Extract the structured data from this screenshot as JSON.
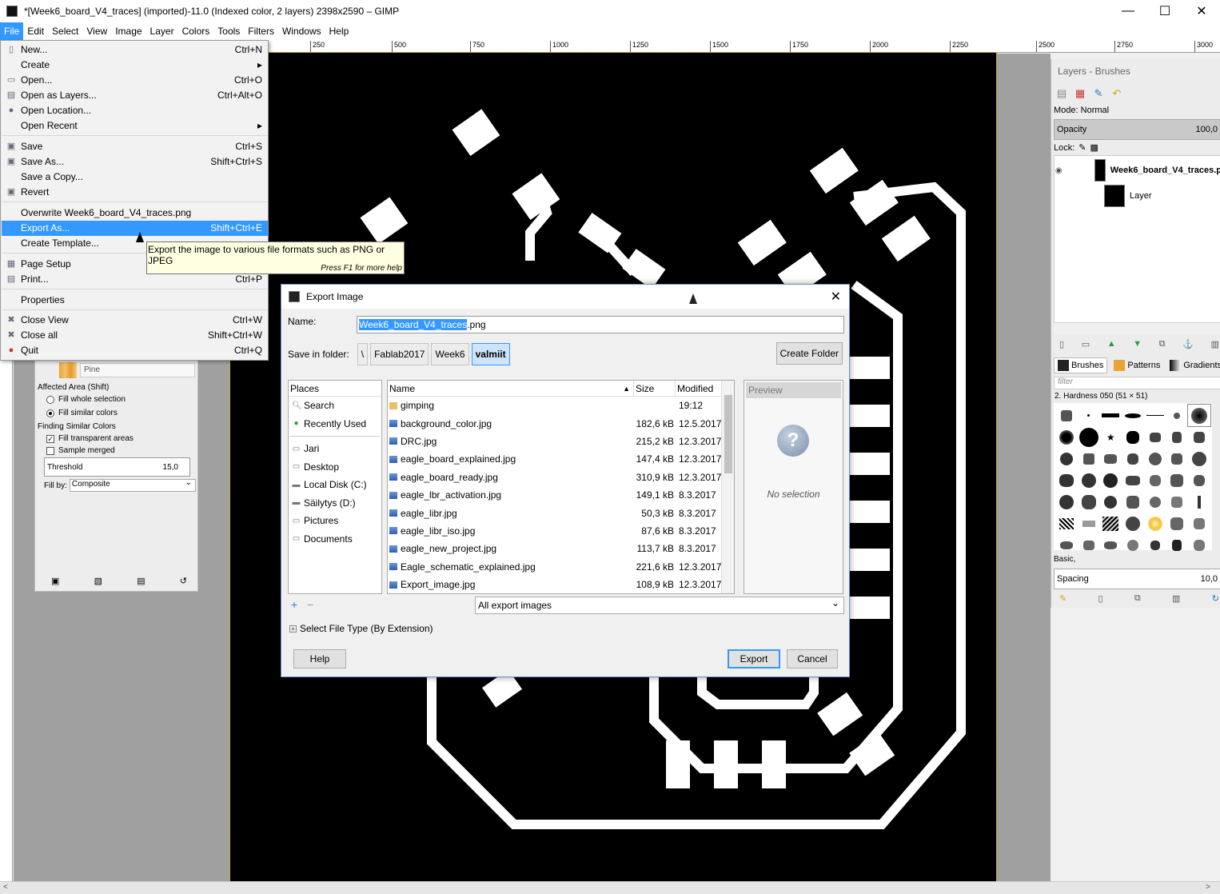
{
  "window": {
    "title": "*[Week6_board_V4_traces] (imported)-11.0 (Indexed color, 2 layers) 2398x2590 – GIMP",
    "minimize": "—",
    "maximize": "☐",
    "close": "✕"
  },
  "menubar": [
    "File",
    "Edit",
    "Select",
    "View",
    "Image",
    "Layer",
    "Colors",
    "Tools",
    "Filters",
    "Windows",
    "Help"
  ],
  "ruler": {
    "top_labels": [
      "250",
      "500",
      "750",
      "1000",
      "1250",
      "1500",
      "1750",
      "2000",
      "2250",
      "2500",
      "2750",
      "3000"
    ]
  },
  "file_menu": {
    "items": [
      {
        "label": "New...",
        "shortcut": "Ctrl+N",
        "icon": "new-icon"
      },
      {
        "label": "Create",
        "shortcut": "▸",
        "icon": ""
      },
      {
        "label": "Open...",
        "shortcut": "Ctrl+O",
        "icon": "open-icon"
      },
      {
        "label": "Open as Layers...",
        "shortcut": "Ctrl+Alt+O",
        "icon": "open-layers-icon"
      },
      {
        "label": "Open Location...",
        "shortcut": "",
        "icon": "globe-icon"
      },
      {
        "label": "Open Recent",
        "shortcut": "▸",
        "icon": ""
      },
      {
        "label": "Save",
        "shortcut": "Ctrl+S",
        "icon": "save-icon"
      },
      {
        "label": "Save As...",
        "shortcut": "Shift+Ctrl+S",
        "icon": "save-as-icon"
      },
      {
        "label": "Save a Copy...",
        "shortcut": "",
        "icon": ""
      },
      {
        "label": "Revert",
        "shortcut": "",
        "icon": "revert-icon"
      },
      {
        "label": "Overwrite Week6_board_V4_traces.png",
        "shortcut": "",
        "icon": ""
      },
      {
        "label": "Export As...",
        "shortcut": "Shift+Ctrl+E",
        "icon": ""
      },
      {
        "label": "Create Template...",
        "shortcut": "",
        "icon": ""
      },
      {
        "label": "Page Setup",
        "shortcut": "",
        "icon": "page-setup-icon"
      },
      {
        "label": "Print...",
        "shortcut": "Ctrl+P",
        "icon": "print-icon"
      },
      {
        "label": "Properties",
        "shortcut": "",
        "icon": ""
      },
      {
        "label": "Close View",
        "shortcut": "Ctrl+W",
        "icon": "close-view-icon"
      },
      {
        "label": "Close all",
        "shortcut": "Shift+Ctrl+W",
        "icon": "close-all-icon"
      },
      {
        "label": "Quit",
        "shortcut": "Ctrl+Q",
        "icon": "quit-icon"
      }
    ]
  },
  "tooltip": {
    "text": "Export the image to various file formats such as PNG or JPEG",
    "help": "Press F1 for more help"
  },
  "tool_options": {
    "pattern_name": "Pine",
    "affected_area": "Affected Area  (Shift)",
    "fill_whole": "Fill whole selection",
    "fill_similar": "Fill similar colors",
    "finding_similar": "Finding Similar Colors",
    "fill_transparent": "Fill transparent areas",
    "sample_merged": "Sample merged",
    "threshold_label": "Threshold",
    "threshold_value": "15,0",
    "fill_by_label": "Fill by:",
    "fill_by_value": "Composite"
  },
  "export_dialog": {
    "title": "Export Image",
    "name_label": "Name:",
    "name_selected": "Week6_board_V4_traces",
    "name_ext": ".png",
    "save_in_label": "Save in folder:",
    "crumbs": [
      "\\",
      "Fablab2017",
      "Week6",
      "valmiit"
    ],
    "create_folder": "Create Folder",
    "places_header": "Places",
    "places": [
      {
        "label": "Search",
        "icon": "search-icon"
      },
      {
        "label": "Recently Used",
        "icon": "recent-icon"
      },
      {
        "label": "Jari",
        "icon": "folder-icon"
      },
      {
        "label": "Desktop",
        "icon": "folder-icon"
      },
      {
        "label": "Local Disk (C:)",
        "icon": "drive-icon"
      },
      {
        "label": "Säilytys (D:)",
        "icon": "drive-icon"
      },
      {
        "label": "Pictures",
        "icon": "folder-icon"
      },
      {
        "label": "Documents",
        "icon": "folder-icon"
      }
    ],
    "columns": {
      "name": "Name",
      "size": "Size",
      "modified": "Modified"
    },
    "files": [
      {
        "name": "gimping",
        "size": "",
        "modified": "19:12",
        "folder": true
      },
      {
        "name": "background_color.jpg",
        "size": "182,6 kB",
        "modified": "12.5.2017"
      },
      {
        "name": "DRC.jpg",
        "size": "215,2 kB",
        "modified": "12.3.2017"
      },
      {
        "name": "eagle_board_explained.jpg",
        "size": "147,4 kB",
        "modified": "12.3.2017"
      },
      {
        "name": "eagle_board_ready.jpg",
        "size": "310,9 kB",
        "modified": "12.3.2017"
      },
      {
        "name": "eagle_lbr_activation.jpg",
        "size": "149,1 kB",
        "modified": "8.3.2017"
      },
      {
        "name": "eagle_libr.jpg",
        "size": "50,3 kB",
        "modified": "8.3.2017"
      },
      {
        "name": "eagle_libr_iso.jpg",
        "size": "87,6 kB",
        "modified": "8.3.2017"
      },
      {
        "name": "eagle_new_project.jpg",
        "size": "113,7 kB",
        "modified": "8.3.2017"
      },
      {
        "name": "Eagle_schematic_explained.jpg",
        "size": "221,6 kB",
        "modified": "12.3.2017"
      },
      {
        "name": "Export_image.jpg",
        "size": "108,9 kB",
        "modified": "12.3.2017"
      }
    ],
    "preview_header": "Preview",
    "preview_text": "No selection",
    "filter_value": "All export images",
    "file_type_label": "Select File Type (By Extension)",
    "help_button": "Help",
    "export_button": "Export",
    "cancel_button": "Cancel"
  },
  "dock": {
    "title": "Layers - Brushes",
    "mode": "Mode: Normal",
    "opacity_label": "Opacity",
    "opacity_value": "100,0",
    "lock_label": "Lock:",
    "layers": [
      {
        "name": "Week6_board_V4_traces.p"
      },
      {
        "name": "Layer"
      }
    ],
    "tabs": [
      "Brushes",
      "Patterns",
      "Gradients"
    ],
    "filter_placeholder": "filter",
    "brush_name": "2. Hardness 050 (51 × 51)",
    "preset": "Basic,",
    "spacing_label": "Spacing",
    "spacing_value": "10,0"
  }
}
